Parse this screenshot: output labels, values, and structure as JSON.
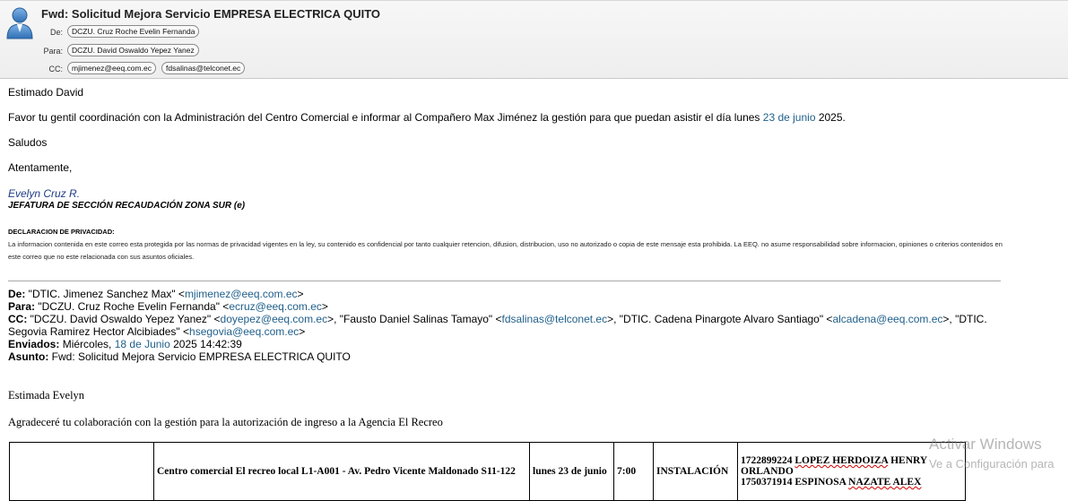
{
  "header": {
    "subject": "Fwd: Solicitud Mejora Servicio EMPRESA ELECTRICA QUITO",
    "de_label": "De:",
    "de_value": "DCZU. Cruz Roche Evelin Fernanda",
    "para_label": "Para:",
    "para_value": "DCZU. David Oswaldo Yepez Yanez",
    "cc_label": "CC:",
    "cc_values": [
      "mjimenez@eeq.com.ec",
      "fdsalinas@telconet.ec"
    ]
  },
  "body": {
    "greeting": "Estimado David",
    "line1_pre": "Favor tu gentil coordinación con la Administración del Centro Comercial e informar al Compañero Max Jiménez la gestión para que puedan asistir el día lunes ",
    "line1_link": "23 de junio",
    "line1_post": " 2025.",
    "saludos": "Saludos",
    "atentamente": "Atentamente,",
    "sig_name": "Evelyn Cruz R.",
    "sig_title": "JEFATURA DE SECCIÓN RECAUDACIÓN ZONA SUR (e)",
    "privacy_title": "DECLARACION DE PRIVACIDAD:",
    "privacy_text": "La informacion contenida en este correo esta protegida por las normas de privacidad vigentes en la ley, su contenido es confidencial por tanto cualquier retencion, difusion, distribucion, uso no autorizado o copia de este mensaje esta prohibida. La EEQ. no asume responsabilidad sobre informacion, opiniones o criterios contenidos en este correo que no este relacionada con sus asuntos oficiales."
  },
  "forward": {
    "de_label": "De:",
    "de_name": " \"DTIC. Jimenez Sanchez Max\" <",
    "de_email": "mjimenez@eeq.com.ec",
    "para_label": "Para:",
    "para_name": " \"DCZU. Cruz Roche Evelin Fernanda\" <",
    "para_email": "ecruz@eeq.com.ec",
    "cc_label": "CC:",
    "cc1_name": " \"DCZU. David Oswaldo Yepez Yanez\" <",
    "cc1_email": "doyepez@eeq.com.ec",
    "cc2_name": ">, \"Fausto Daniel Salinas Tamayo\" <",
    "cc2_email": "fdsalinas@telconet.ec",
    "cc3_name": ">, \"DTIC. Cadena Pinargote Alvaro Santiago\" <",
    "cc3_email": "alcadena@eeq.com.ec",
    "cc4_name": ">, \"DTIC. Segovia Ramirez Hector Alcibiades\" <",
    "cc4_email": "hsegovia@eeq.com.ec",
    "close": ">",
    "enviados_label": "Enviados:",
    "enviados_pre": " Miércoles, ",
    "enviados_link": "18 de Junio",
    "enviados_post": " 2025 14:42:39",
    "asunto_label": "Asunto:",
    "asunto_value": " Fwd: Solicitud Mejora Servicio EMPRESA ELECTRICA QUITO",
    "greeting": "Estimada Evelyn",
    "text": "Agradeceré tu colaboración con la gestión para la autorización de ingreso a la Agencia El Recreo"
  },
  "table": {
    "location": "Centro comercial El recreo local L1-A001 - Av. Pedro Vicente Maldonado S11-122",
    "date": "lunes 23 de junio",
    "time": "7:00",
    "type": "INSTALACIÓN",
    "p1_id": "1722899224 ",
    "p1_name": "LOPEZ HERDOIZA",
    "p1_rest": " HENRY ORLANDO",
    "p2_id": "1750371914 ESPINOSA ",
    "p2_name": "NAZATE ALEX"
  },
  "watermark": {
    "line1": "Activar Windows",
    "line2": "Ve a Configuración para"
  }
}
